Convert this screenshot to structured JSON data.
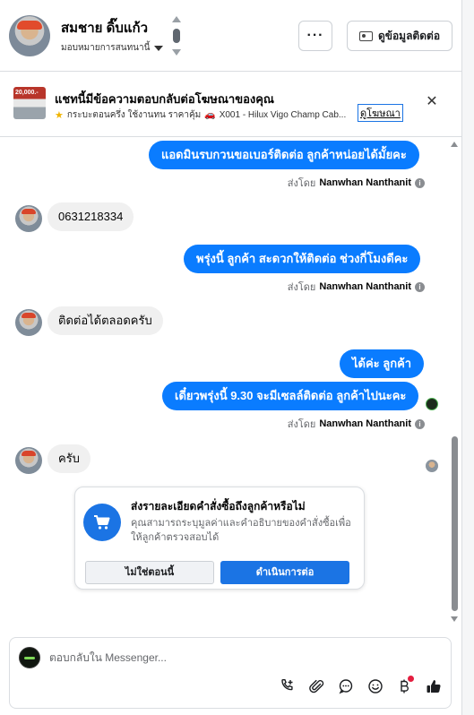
{
  "header": {
    "user_name": "สมชาย ดิ๊บแก้ว",
    "assign_label": "มอบหมายการสนทนานี้",
    "more_label": "···",
    "contact_label": "ดูข้อมูลติดต่อ"
  },
  "ad_banner": {
    "thumb_text": "20,000.-",
    "title": "แชทนี้มีข้อความตอบกลับต่อโฆษณาของคุณ",
    "subtitle": "กระบะตอนครึ่ง ใช้งานทน ราคาคุ้ม",
    "ad_name": "X001 - Hilux Vigo Champ Cab...",
    "link_label": "ดูโฆษณา"
  },
  "messages": [
    {
      "side": "out",
      "text": "แอดมินรบกวนขอเบอร์ติดต่อ ลูกค้าหน่อยได้มั้ยคะ"
    },
    {
      "side": "meta",
      "prefix": "ส่งโดย",
      "sender": "Nanwhan Nanthanit"
    },
    {
      "side": "in",
      "text": "0631218334"
    },
    {
      "side": "out",
      "text": "พรุ่งนี้ ลูกค้า สะดวกให้ติดต่อ ช่วงกี่โมงดีคะ"
    },
    {
      "side": "meta",
      "prefix": "ส่งโดย",
      "sender": "Nanwhan Nanthanit"
    },
    {
      "side": "in",
      "text": "ติดต่อได้ตลอดครับ"
    },
    {
      "side": "out",
      "text": "ได้ค่ะ  ลูกค้า"
    },
    {
      "side": "out",
      "text": "เดี๋ยวพรุ่งนี้ 9.30 จะมีเซลล์ติดต่อ ลูกค้าไปนะคะ"
    },
    {
      "side": "meta",
      "prefix": "ส่งโดย",
      "sender": "Nanwhan Nanthanit"
    },
    {
      "side": "in",
      "text": "ครับ"
    }
  ],
  "order_card": {
    "title": "ส่งรายละเอียดคำสั่งซื้อถึงลูกค้าหรือไม่",
    "description": "คุณสามารถระบุมูลค่าและคำอธิบายของคำสั่งซื้อเพื่อให้ลูกค้าตรวจสอบได้",
    "not_now_label": "ไม่ใช่ตอนนี้",
    "proceed_label": "ดำเนินการต่อ"
  },
  "composer": {
    "placeholder": "ตอบกลับใน Messenger..."
  },
  "colors": {
    "brand_blue": "#0a7cff",
    "button_blue": "#1b74e4",
    "incoming_bg": "#f0f0f0"
  },
  "icons": [
    "phone-plus-icon",
    "paperclip-icon",
    "chat-bubble-icon",
    "emoji-icon",
    "baht-icon",
    "thumbs-up-icon"
  ]
}
